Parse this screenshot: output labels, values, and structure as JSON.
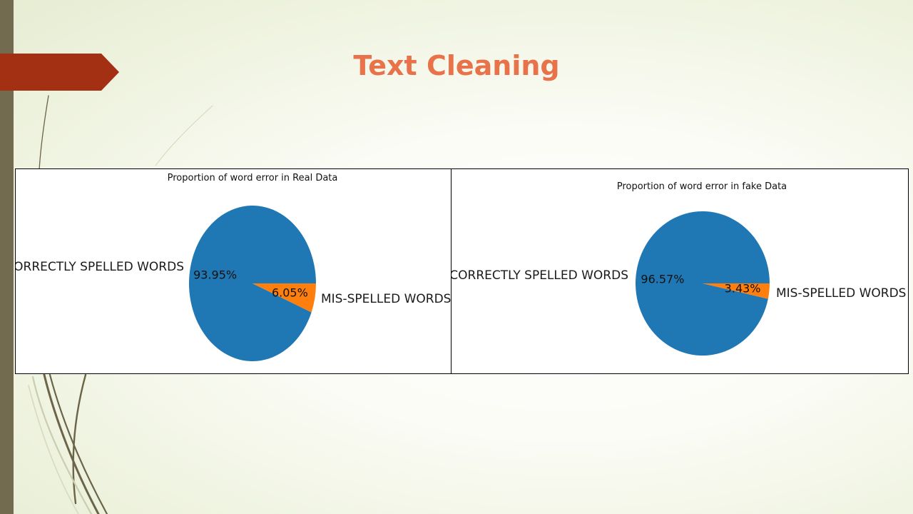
{
  "slide": {
    "title": "Text Cleaning",
    "colors": {
      "title": "#e8734a",
      "arrow": "#a33012",
      "left_bar": "#736b50",
      "background": "#f0f4e2"
    }
  },
  "chart_data": [
    {
      "type": "pie",
      "title": "Proportion of word error in Real Data",
      "labels": [
        "CORRECTLY SPELLED WORDS",
        "MIS-SPELLED WORDS"
      ],
      "values": [
        93.95,
        6.05
      ],
      "percent_labels": [
        "93.95%",
        "6.05%"
      ],
      "colors": [
        "#1f77b4",
        "#ff7f0e"
      ],
      "legend": "none"
    },
    {
      "type": "pie",
      "title": "Proportion of word error in fake Data",
      "labels": [
        "CORRECTLY SPELLED WORDS",
        "MIS-SPELLED WORDS"
      ],
      "values": [
        96.57,
        3.43
      ],
      "percent_labels": [
        "96.57%",
        "3.43%"
      ],
      "colors": [
        "#1f77b4",
        "#ff7f0e"
      ],
      "legend": "none"
    }
  ]
}
